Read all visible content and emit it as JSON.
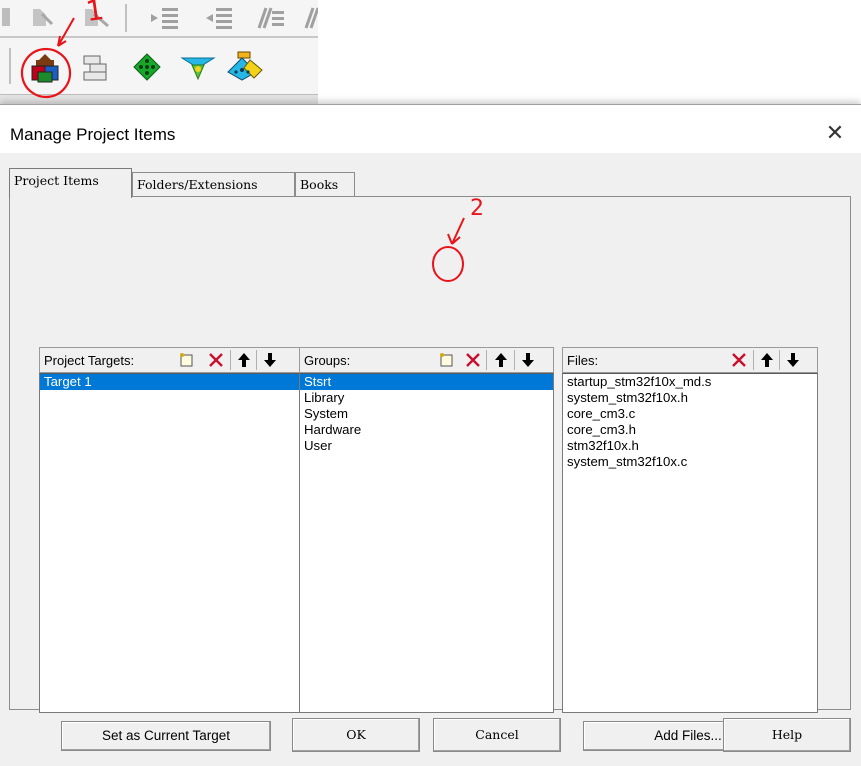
{
  "toolbar": {
    "icons": [
      "indent-icon",
      "unindent-icon",
      "comment-icon",
      "uncomment-icon",
      "manage-project-items-icon",
      "batch-build-icon",
      "select-packs-icon",
      "manage-run-time-icon",
      "pack-installer-icon"
    ]
  },
  "annotations": {
    "mark1": "1",
    "mark2": "2",
    "color": "#e8141a"
  },
  "dialog": {
    "title": "Manage Project Items",
    "close_glyph": "✕",
    "tabs": [
      {
        "label": "Project Items",
        "active": true
      },
      {
        "label": "Folders/Extensions",
        "active": false
      },
      {
        "label": "Books",
        "active": false
      }
    ],
    "targets": {
      "label": "Project Targets:",
      "items": [
        "Target 1"
      ],
      "selected": "Target 1"
    },
    "groups": {
      "label": "Groups:",
      "items": [
        "Stsrt",
        "Library",
        "System",
        "Hardware",
        "User"
      ],
      "selected": "Stsrt"
    },
    "files": {
      "label": "Files:",
      "items": [
        "startup_stm32f10x_md.s",
        "system_stm32f10x.h",
        "core_cm3.c",
        "core_cm3.h",
        "stm32f10x.h",
        "system_stm32f10x.c"
      ]
    },
    "set_current_label": "Set as Current Target",
    "add_files_label": "Add Files...",
    "ok_label": "OK",
    "cancel_label": "Cancel",
    "help_label": "Help",
    "colors": {
      "selection": "#0078d7",
      "delete": "#c8102e"
    }
  }
}
